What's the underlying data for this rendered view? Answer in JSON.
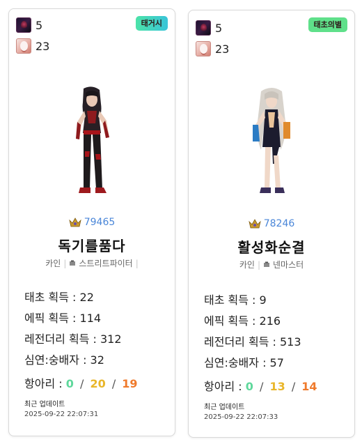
{
  "cards": [
    {
      "stat_a": "5",
      "stat_b": "23",
      "badge": "태거시",
      "fame": "79465",
      "name": "독기를품다",
      "job_base": "카인",
      "job_class": "스트리트파이터",
      "taecho": "태초 획득 : 22",
      "epic": "에픽 획득 : 114",
      "legendary": "레전더리 획득 : 312",
      "simyeon": "심연:숭배자 : 32",
      "hang_label": "항아리 :",
      "hang_green": "0",
      "hang_yellow": "20",
      "hang_orange": "19",
      "updated_label": "최근 업데이트",
      "updated_time": "2025-09-22 22:07:31"
    },
    {
      "stat_a": "5",
      "stat_b": "23",
      "badge": "태초의별",
      "fame": "78246",
      "name": "활성화순결",
      "job_base": "카인",
      "job_class": "넨마스터",
      "taecho": "태초 획득 : 9",
      "epic": "에픽 획득 : 216",
      "legendary": "레전더리 획득 : 513",
      "simyeon": "심연:숭배자 : 57",
      "hang_label": "항아리 :",
      "hang_green": "0",
      "hang_yellow": "13",
      "hang_orange": "14",
      "updated_label": "최근 업데이트",
      "updated_time": "2025-09-22 22:07:33"
    }
  ],
  "separator": "|",
  "slash": "/",
  "colors": {
    "fame": "#4a86d8",
    "hang_green": "#5fd89c",
    "hang_yellow": "#e9b62a",
    "hang_orange": "#ef7a2c"
  },
  "icons": {
    "stat_a": "dark-character-icon",
    "stat_b": "white-character-icon",
    "fame": "fame-crown-icon",
    "job": "job-icon"
  }
}
